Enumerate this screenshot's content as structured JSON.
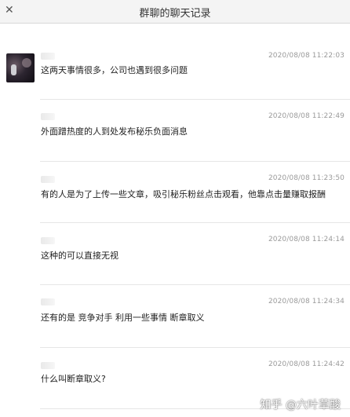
{
  "window": {
    "title": "群聊的聊天记录",
    "close_glyph": "✕"
  },
  "messages": [
    {
      "time": "2020/08/08 11:22:03",
      "text": "这两天事情很多，公司也遇到很多问题"
    },
    {
      "time": "2020/08/08 11:22:49",
      "text": "外面蹭热度的人到处发布秘乐负面消息"
    },
    {
      "time": "2020/08/08 11:23:50",
      "text": "有的人是为了上传一些文章，吸引秘乐粉丝点击观看，他靠点击量赚取报酬"
    },
    {
      "time": "2020/08/08 11:24:14",
      "text": "这种的可以直接无视"
    },
    {
      "time": "2020/08/08 11:24:34",
      "text": "还有的是 竞争对手  利用一些事情 断章取义"
    },
    {
      "time": "2020/08/08 11:24:42",
      "text": "什么叫断章取义?"
    }
  ],
  "watermark": "知乎 @六叶草酸"
}
